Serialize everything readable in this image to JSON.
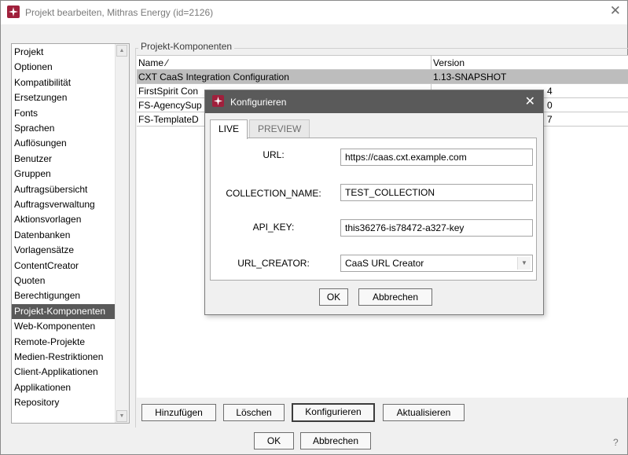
{
  "window": {
    "title": "Projekt bearbeiten, Mithras Energy (id=2126)",
    "close_glyph": "✕"
  },
  "nav": {
    "items": [
      "Projekt",
      "Optionen",
      "Kompatibilität",
      "Ersetzungen",
      "Fonts",
      "Sprachen",
      "Auflösungen",
      "Benutzer",
      "Gruppen",
      "Auftragsübersicht",
      "Auftragsverwaltung",
      "Aktionsvorlagen",
      "Datenbanken",
      "Vorlagensätze",
      "ContentCreator",
      "Quoten",
      "Berechtigungen",
      "Projekt-Komponenten",
      "Web-Komponenten",
      "Remote-Projekte",
      "Medien-Restriktionen",
      "Client-Applikationen",
      "Applikationen",
      "Repository"
    ],
    "selected_index": 17
  },
  "components": {
    "group_title": "Projekt-Komponenten",
    "columns": {
      "name": "Name ⁄",
      "version": "Version"
    },
    "rows": [
      {
        "name": "CXT CaaS Integration Configuration",
        "version": "1.13-SNAPSHOT",
        "selected": true
      },
      {
        "name": "FirstSpirit Con",
        "version": "4"
      },
      {
        "name": "FS-AgencySup",
        "version": "0"
      },
      {
        "name": "FS-TemplateD",
        "version": "7"
      }
    ],
    "buttons": {
      "add": "Hinzufügen",
      "delete": "Löschen",
      "configure": "Konfigurieren",
      "refresh": "Aktualisieren"
    }
  },
  "footer": {
    "ok": "OK",
    "cancel": "Abbrechen",
    "help_glyph": "?"
  },
  "dialog": {
    "title": "Konfigurieren",
    "close_glyph": "✕",
    "tabs": [
      {
        "label": "LIVE",
        "active": true
      },
      {
        "label": "PREVIEW",
        "active": false
      }
    ],
    "fields": {
      "url": {
        "label": "URL:",
        "value": "https://caas.cxt.example.com"
      },
      "collection": {
        "label": "COLLECTION_NAME:",
        "value": "TEST_COLLECTION"
      },
      "api_key": {
        "label": "API_KEY:",
        "value": "this36276-is78472-a327-key"
      },
      "url_creator": {
        "label": "URL_CREATOR:",
        "value": "CaaS URL Creator"
      }
    },
    "ok": "OK",
    "cancel": "Abbrechen"
  },
  "colors": {
    "accent_icon": "#a0203c",
    "selection_nav": "#595959",
    "selection_row": "#bdbdbd",
    "dialog_titlebar": "#5a5a5a"
  }
}
